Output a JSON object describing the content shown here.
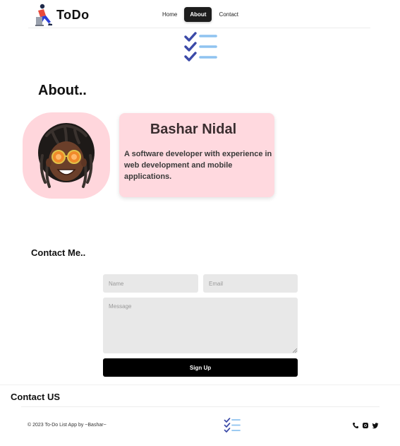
{
  "header": {
    "brand": "ToDo",
    "nav": [
      {
        "label": "Home",
        "active": false
      },
      {
        "label": "About",
        "active": true
      },
      {
        "label": "Contact",
        "active": false
      }
    ]
  },
  "about": {
    "title": "About..",
    "name": "Bashar Nidal",
    "bio": "A software developer with experience in web development and mobile applications."
  },
  "contact": {
    "title": "Contact Me..",
    "name_placeholder": "Name",
    "email_placeholder": "Email",
    "message_placeholder": "Message",
    "submit_label": "Sign Up"
  },
  "footer": {
    "title": "Contact US",
    "copyright": "© 2023 To-Do List App by ~Bashar~",
    "socials": [
      "phone-icon",
      "instagram-icon",
      "twitter-icon"
    ]
  },
  "colors": {
    "accent_pink": "#ffd6dc",
    "checklist_check": "#3b4aa8",
    "checklist_line": "#8fc3f0",
    "button_dark": "#000000"
  }
}
